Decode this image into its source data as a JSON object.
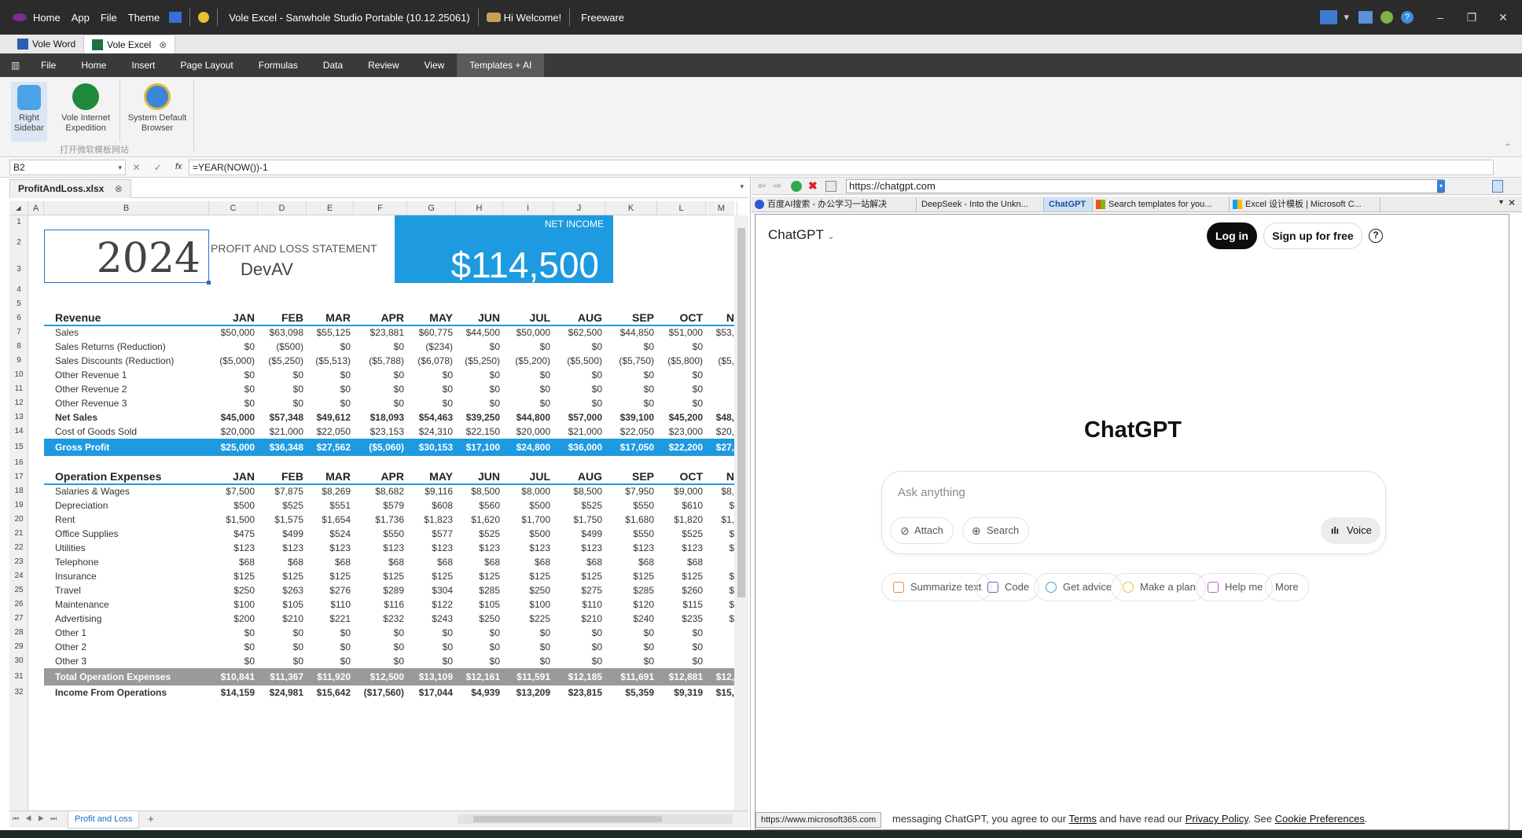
{
  "titlebar": {
    "menu_home": "Home",
    "menu_app": "App",
    "menu_file": "File",
    "menu_theme": "Theme",
    "app_title": "Vole Excel - Sanwhole Studio Portable (10.12.25061)",
    "welcome": "Hi Welcome!",
    "license": "Freeware"
  },
  "doc_tabs": [
    "Vole Word",
    "Vole Excel"
  ],
  "menu": [
    "File",
    "Home",
    "Insert",
    "Page Layout",
    "Formulas",
    "Data",
    "Review",
    "View",
    "Templates + AI"
  ],
  "ribbon": {
    "right_sidebar_label": "Right Sidebar",
    "vie_label": "Vole Internet Expedition",
    "browser_label": "System Default Browser",
    "group_caption": "打开微软模板网站"
  },
  "formula_bar": {
    "name_box": "B2",
    "formula": "=YEAR(NOW())-1"
  },
  "sheet": {
    "file_tab": "ProfitAndLoss.xlsx",
    "columns": [
      "A",
      "B",
      "C",
      "D",
      "E",
      "F",
      "G",
      "H",
      "I",
      "J",
      "K",
      "L",
      "M"
    ],
    "rows": [
      "1",
      "2",
      "3",
      "4",
      "5",
      "6",
      "7",
      "8",
      "9",
      "10",
      "11",
      "12",
      "13",
      "14",
      "15",
      "16",
      "17",
      "18",
      "19",
      "20",
      "21",
      "22",
      "23",
      "24",
      "25",
      "26",
      "27",
      "28",
      "29",
      "30",
      "31",
      "32"
    ],
    "year": "2024",
    "pl_title": "PROFIT AND LOSS STATEMENT",
    "company": "DevAV",
    "net_income_label": "NET INCOME",
    "net_income_value": "$114,500",
    "months": [
      "JAN",
      "FEB",
      "MAR",
      "APR",
      "MAY",
      "JUN",
      "JUL",
      "AUG",
      "SEP",
      "OCT",
      "N"
    ],
    "revenue_header": "Revenue",
    "revenue_rows": [
      {
        "label": "Sales",
        "values": [
          "$50,000",
          "$63,098",
          "$55,125",
          "$23,881",
          "$60,775",
          "$44,500",
          "$50,000",
          "$62,500",
          "$44,850",
          "$51,000",
          "$53,"
        ]
      },
      {
        "label": "Sales Returns (Reduction)",
        "values": [
          "$0",
          "($500)",
          "$0",
          "$0",
          "($234)",
          "$0",
          "$0",
          "$0",
          "$0",
          "$0",
          ""
        ]
      },
      {
        "label": "Sales Discounts (Reduction)",
        "values": [
          "($5,000)",
          "($5,250)",
          "($5,513)",
          "($5,788)",
          "($6,078)",
          "($5,250)",
          "($5,200)",
          "($5,500)",
          "($5,750)",
          "($5,800)",
          "($5,"
        ]
      },
      {
        "label": "Other Revenue 1",
        "values": [
          "$0",
          "$0",
          "$0",
          "$0",
          "$0",
          "$0",
          "$0",
          "$0",
          "$0",
          "$0",
          ""
        ]
      },
      {
        "label": "Other Revenue 2",
        "values": [
          "$0",
          "$0",
          "$0",
          "$0",
          "$0",
          "$0",
          "$0",
          "$0",
          "$0",
          "$0",
          ""
        ]
      },
      {
        "label": "Other Revenue 3",
        "values": [
          "$0",
          "$0",
          "$0",
          "$0",
          "$0",
          "$0",
          "$0",
          "$0",
          "$0",
          "$0",
          ""
        ]
      },
      {
        "label": "Net Sales",
        "values": [
          "$45,000",
          "$57,348",
          "$49,612",
          "$18,093",
          "$54,463",
          "$39,250",
          "$44,800",
          "$57,000",
          "$39,100",
          "$45,200",
          "$48,"
        ],
        "bold": true
      },
      {
        "label": "Cost of Goods Sold",
        "values": [
          "$20,000",
          "$21,000",
          "$22,050",
          "$23,153",
          "$24,310",
          "$22,150",
          "$20,000",
          "$21,000",
          "$22,050",
          "$23,000",
          "$20,"
        ]
      }
    ],
    "gross_profit": {
      "label": "Gross Profit",
      "values": [
        "$25,000",
        "$36,348",
        "$27,562",
        "($5,060)",
        "$30,153",
        "$17,100",
        "$24,800",
        "$36,000",
        "$17,050",
        "$22,200",
        "$27,"
      ]
    },
    "opex_header": "Operation Expenses",
    "opex_rows": [
      {
        "label": "Salaries & Wages",
        "values": [
          "$7,500",
          "$7,875",
          "$8,269",
          "$8,682",
          "$9,116",
          "$8,500",
          "$8,000",
          "$8,500",
          "$7,950",
          "$9,000",
          "$8,"
        ]
      },
      {
        "label": "Depreciation",
        "values": [
          "$500",
          "$525",
          "$551",
          "$579",
          "$608",
          "$560",
          "$500",
          "$525",
          "$550",
          "$610",
          "$"
        ]
      },
      {
        "label": "Rent",
        "values": [
          "$1,500",
          "$1,575",
          "$1,654",
          "$1,736",
          "$1,823",
          "$1,620",
          "$1,700",
          "$1,750",
          "$1,680",
          "$1,820",
          "$1,"
        ]
      },
      {
        "label": "Office Supplies",
        "values": [
          "$475",
          "$499",
          "$524",
          "$550",
          "$577",
          "$525",
          "$500",
          "$499",
          "$550",
          "$525",
          "$"
        ]
      },
      {
        "label": "Utilities",
        "values": [
          "$123",
          "$123",
          "$123",
          "$123",
          "$123",
          "$123",
          "$123",
          "$123",
          "$123",
          "$123",
          "$"
        ]
      },
      {
        "label": "Telephone",
        "values": [
          "$68",
          "$68",
          "$68",
          "$68",
          "$68",
          "$68",
          "$68",
          "$68",
          "$68",
          "$68",
          ""
        ]
      },
      {
        "label": "Insurance",
        "values": [
          "$125",
          "$125",
          "$125",
          "$125",
          "$125",
          "$125",
          "$125",
          "$125",
          "$125",
          "$125",
          "$"
        ]
      },
      {
        "label": "Travel",
        "values": [
          "$250",
          "$263",
          "$276",
          "$289",
          "$304",
          "$285",
          "$250",
          "$275",
          "$285",
          "$260",
          "$"
        ]
      },
      {
        "label": "Maintenance",
        "values": [
          "$100",
          "$105",
          "$110",
          "$116",
          "$122",
          "$105",
          "$100",
          "$110",
          "$120",
          "$115",
          "$"
        ]
      },
      {
        "label": "Advertising",
        "values": [
          "$200",
          "$210",
          "$221",
          "$232",
          "$243",
          "$250",
          "$225",
          "$210",
          "$240",
          "$235",
          "$"
        ]
      },
      {
        "label": "Other 1",
        "values": [
          "$0",
          "$0",
          "$0",
          "$0",
          "$0",
          "$0",
          "$0",
          "$0",
          "$0",
          "$0",
          ""
        ]
      },
      {
        "label": "Other 2",
        "values": [
          "$0",
          "$0",
          "$0",
          "$0",
          "$0",
          "$0",
          "$0",
          "$0",
          "$0",
          "$0",
          ""
        ]
      },
      {
        "label": "Other 3",
        "values": [
          "$0",
          "$0",
          "$0",
          "$0",
          "$0",
          "$0",
          "$0",
          "$0",
          "$0",
          "$0",
          ""
        ]
      }
    ],
    "total_opex": {
      "label": "Total Operation Expenses",
      "values": [
        "$10,841",
        "$11,367",
        "$11,920",
        "$12,500",
        "$13,109",
        "$12,161",
        "$11,591",
        "$12,185",
        "$11,691",
        "$12,881",
        "$12,"
      ]
    },
    "income_ops": {
      "label": "Income From Operations",
      "values": [
        "$14,159",
        "$24,981",
        "$15,642",
        "($17,560)",
        "$17,044",
        "$4,939",
        "$13,209",
        "$23,815",
        "$5,359",
        "$9,319",
        "$15,"
      ]
    },
    "sheet_tab": "Profit and Loss",
    "add_sheet": "+"
  },
  "browser": {
    "url": "https://chatgpt.com",
    "tabs": [
      "百度AI搜索 - 办公学习一站解决",
      "DeepSeek - Into the Unkn...",
      "ChatGPT",
      "Search templates for you...",
      "Excel 设计模板 | Microsoft C..."
    ],
    "status_url": "https://www.microsoft365.com",
    "gpt": {
      "model": "ChatGPT",
      "login": "Log in",
      "signup": "Sign up for free",
      "help": "?",
      "heading": "ChatGPT",
      "placeholder": "Ask anything",
      "attach": "Attach",
      "search": "Search",
      "voice": "Voice",
      "suggestions": [
        "Summarize text",
        "Code",
        "Get advice",
        "Make a plan",
        "Help me",
        "More"
      ],
      "footer_pre": "messaging ChatGPT, you agree to our",
      "terms": "Terms",
      "footer_mid": "and have read our",
      "privacy": "Privacy Policy",
      "footer_see": ". See",
      "cookies": "Cookie Preferences",
      "footer_end": "."
    }
  },
  "colors": {
    "accent_blue": "#1e9ae0",
    "gray_band": "#9a9a9a",
    "title_bar": "#2b2b2b",
    "menu_bar": "#3a3a3a"
  }
}
